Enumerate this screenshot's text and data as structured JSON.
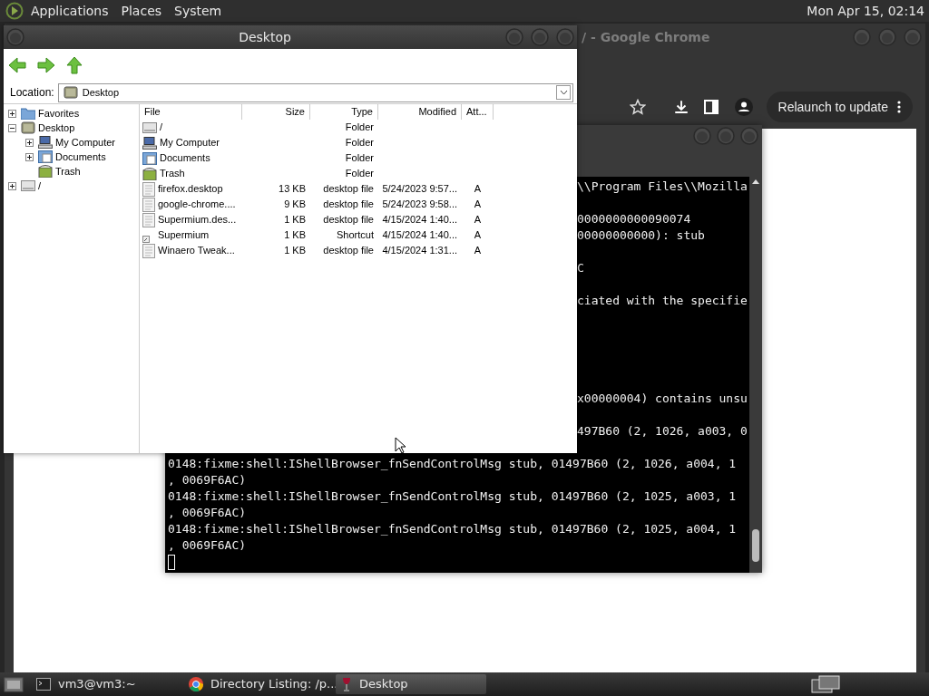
{
  "top_panel": {
    "menus": [
      "Applications",
      "Places",
      "System"
    ],
    "clock": "Mon Apr 15, 02:14"
  },
  "browser_window": {
    "title": "/ - Google Chrome",
    "update_button": "Relaunch to update"
  },
  "terminal": {
    "lines": [
      {
        "kind": "partial",
        "text": "\\\\Program Files\\\\Mozilla"
      },
      {
        "kind": "blank"
      },
      {
        "kind": "partial",
        "text": "0000000000090074"
      },
      {
        "kind": "partial",
        "text": "00000000000): stub"
      },
      {
        "kind": "blank"
      },
      {
        "kind": "partial",
        "text": "C"
      },
      {
        "kind": "blank"
      },
      {
        "kind": "partial",
        "text": "ciated with the specifie"
      },
      {
        "kind": "blank"
      },
      {
        "kind": "blank"
      },
      {
        "kind": "blank"
      },
      {
        "kind": "blank"
      },
      {
        "kind": "blank"
      },
      {
        "kind": "partial",
        "text": "x00000004) contains unsu"
      },
      {
        "kind": "blank"
      },
      {
        "kind": "partial",
        "text": "497B60 (2, 1026, a003, 0"
      },
      {
        "kind": "blank"
      },
      {
        "kind": "full",
        "text": "0148:fixme:shell:IShellBrowser_fnSendControlMsg stub, 01497B60 (2, 1026, a004, 1"
      },
      {
        "kind": "full",
        "text": ", 0069F6AC)"
      },
      {
        "kind": "full",
        "text": "0148:fixme:shell:IShellBrowser_fnSendControlMsg stub, 01497B60 (2, 1025, a003, 1"
      },
      {
        "kind": "full",
        "text": ", 0069F6AC)"
      },
      {
        "kind": "full",
        "text": "0148:fixme:shell:IShellBrowser_fnSendControlMsg stub, 01497B60 (2, 1025, a004, 1"
      },
      {
        "kind": "full",
        "text": ", 0069F6AC)"
      },
      {
        "kind": "cursor"
      }
    ]
  },
  "file_manager": {
    "title": "Desktop",
    "location": {
      "label": "Location:",
      "value": "Desktop"
    },
    "tree": [
      {
        "label": "Favorites",
        "kind": "folder",
        "expanded": false
      },
      {
        "label": "Desktop",
        "kind": "desktop",
        "expanded": true,
        "children": [
          {
            "label": "My Computer",
            "kind": "computer",
            "expanded": false
          },
          {
            "label": "Documents",
            "kind": "documents",
            "expanded": false
          },
          {
            "label": "Trash",
            "kind": "trash"
          }
        ]
      },
      {
        "label": "/",
        "kind": "drive",
        "expanded": false
      }
    ],
    "columns": [
      "File",
      "Size",
      "Type",
      "Modified",
      "Att..."
    ],
    "rows": [
      {
        "kind": "drive",
        "name": "/",
        "type": "Folder"
      },
      {
        "kind": "computer",
        "name": "My Computer",
        "type": "Folder"
      },
      {
        "kind": "documents",
        "name": "Documents",
        "type": "Folder"
      },
      {
        "kind": "trash",
        "name": "Trash",
        "type": "Folder"
      },
      {
        "kind": "file",
        "name": "firefox.desktop",
        "size": "13 KB",
        "type": "desktop file",
        "modified": "5/24/2023 9:57...",
        "attributes": "A"
      },
      {
        "kind": "file",
        "name": "google-chrome....",
        "size": "9 KB",
        "type": "desktop file",
        "modified": "5/24/2023 9:58...",
        "attributes": "A"
      },
      {
        "kind": "file",
        "name": "Supermium.des...",
        "size": "1 KB",
        "type": "desktop file",
        "modified": "4/15/2024 1:40...",
        "attributes": "A"
      },
      {
        "kind": "shortcut",
        "name": "Supermium",
        "size": "1 KB",
        "type": "Shortcut",
        "modified": "4/15/2024 1:40...",
        "attributes": "A"
      },
      {
        "kind": "file",
        "name": "Winaero Tweak...",
        "size": "1 KB",
        "type": "desktop file",
        "modified": "4/15/2024 1:31...",
        "attributes": "A"
      }
    ]
  },
  "taskbar": {
    "items": [
      {
        "kind": "terminal",
        "label": "vm3@vm3:~",
        "selected": false
      },
      {
        "kind": "chrome",
        "label": "Directory Listing: /p...",
        "selected": false
      },
      {
        "kind": "wine",
        "label": "Desktop",
        "selected": true
      }
    ]
  }
}
